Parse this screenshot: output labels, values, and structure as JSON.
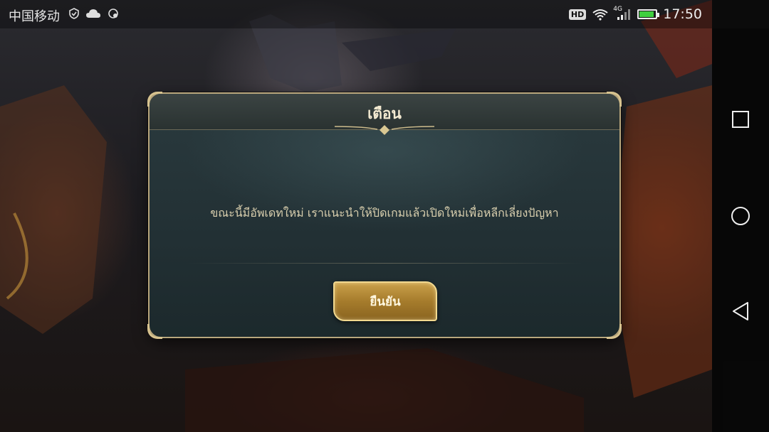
{
  "status_bar": {
    "carrier": "中国移动",
    "network_type": "4G",
    "hd_badge": "HD",
    "time": "17:50",
    "battery_percent": 90,
    "icons": [
      "shield-check-icon",
      "cloud-icon",
      "gear-shield-icon",
      "wifi-icon",
      "cellular-signal-icon",
      "battery-charging-icon"
    ]
  },
  "dialog": {
    "title": "เตือน",
    "message": "ขณะนี้มีอัพเดทใหม่ เราแนะนำให้ปิดเกมแล้วเปิดใหม่เพื่อหลีกเลี่ยงปัญหา",
    "confirm_label": "ยืนยัน"
  },
  "nav_bar": {
    "buttons": [
      "recent-apps-square-icon",
      "home-circle-icon",
      "back-triangle-icon"
    ]
  },
  "colors": {
    "dialog_border": "#b9a77d",
    "title_text": "#f3ead1",
    "message_text": "#d9cfae",
    "button_gold": "#c9a04a",
    "battery_green": "#3fcf3f"
  }
}
